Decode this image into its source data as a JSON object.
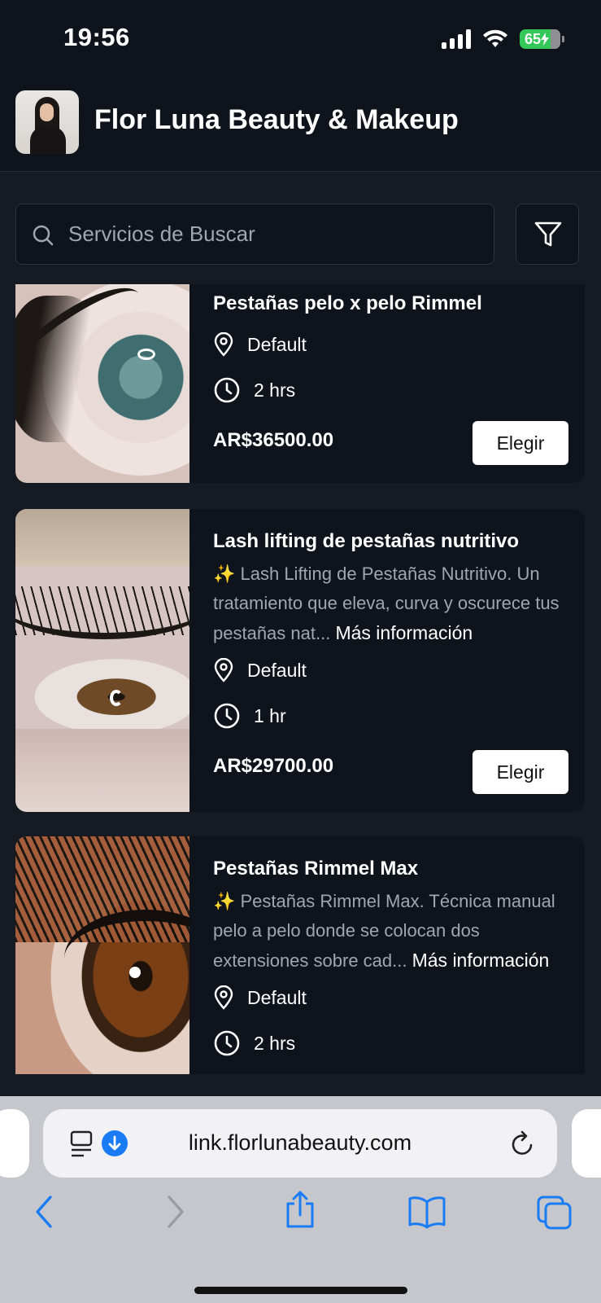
{
  "status_bar": {
    "time": "19:56",
    "battery": "65"
  },
  "header": {
    "title": "Flor Luna Beauty & Makeup"
  },
  "search": {
    "placeholder": "Servicios de Buscar"
  },
  "services": [
    {
      "title": "Pestañas pelo x pelo Rimmel",
      "location": "Default",
      "duration": "2 hrs",
      "price": "AR$36500.00",
      "button": "Elegir"
    },
    {
      "title": "Lash lifting de pestañas nutritivo",
      "description": "✨ Lash Lifting de Pestañas Nutritivo. Un tratamiento que eleva, curva y oscurece tus pestañas nat...",
      "more": "Más información",
      "location": "Default",
      "duration": "1 hr",
      "price": "AR$29700.00",
      "button": "Elegir"
    },
    {
      "title": "Pestañas Rimmel Max",
      "description": "✨ Pestañas Rimmel Max. Técnica manual pelo a pelo donde se colocan dos extensiones sobre cad...",
      "more": "Más información",
      "location": "Default",
      "duration": "2 hrs"
    }
  ],
  "browser": {
    "url": "link.florlunabeauty.com"
  },
  "colors": {
    "background": "#161b23",
    "card": "#0f141c",
    "accent_blue": "#1a7cf5",
    "battery_green": "#34c759"
  }
}
